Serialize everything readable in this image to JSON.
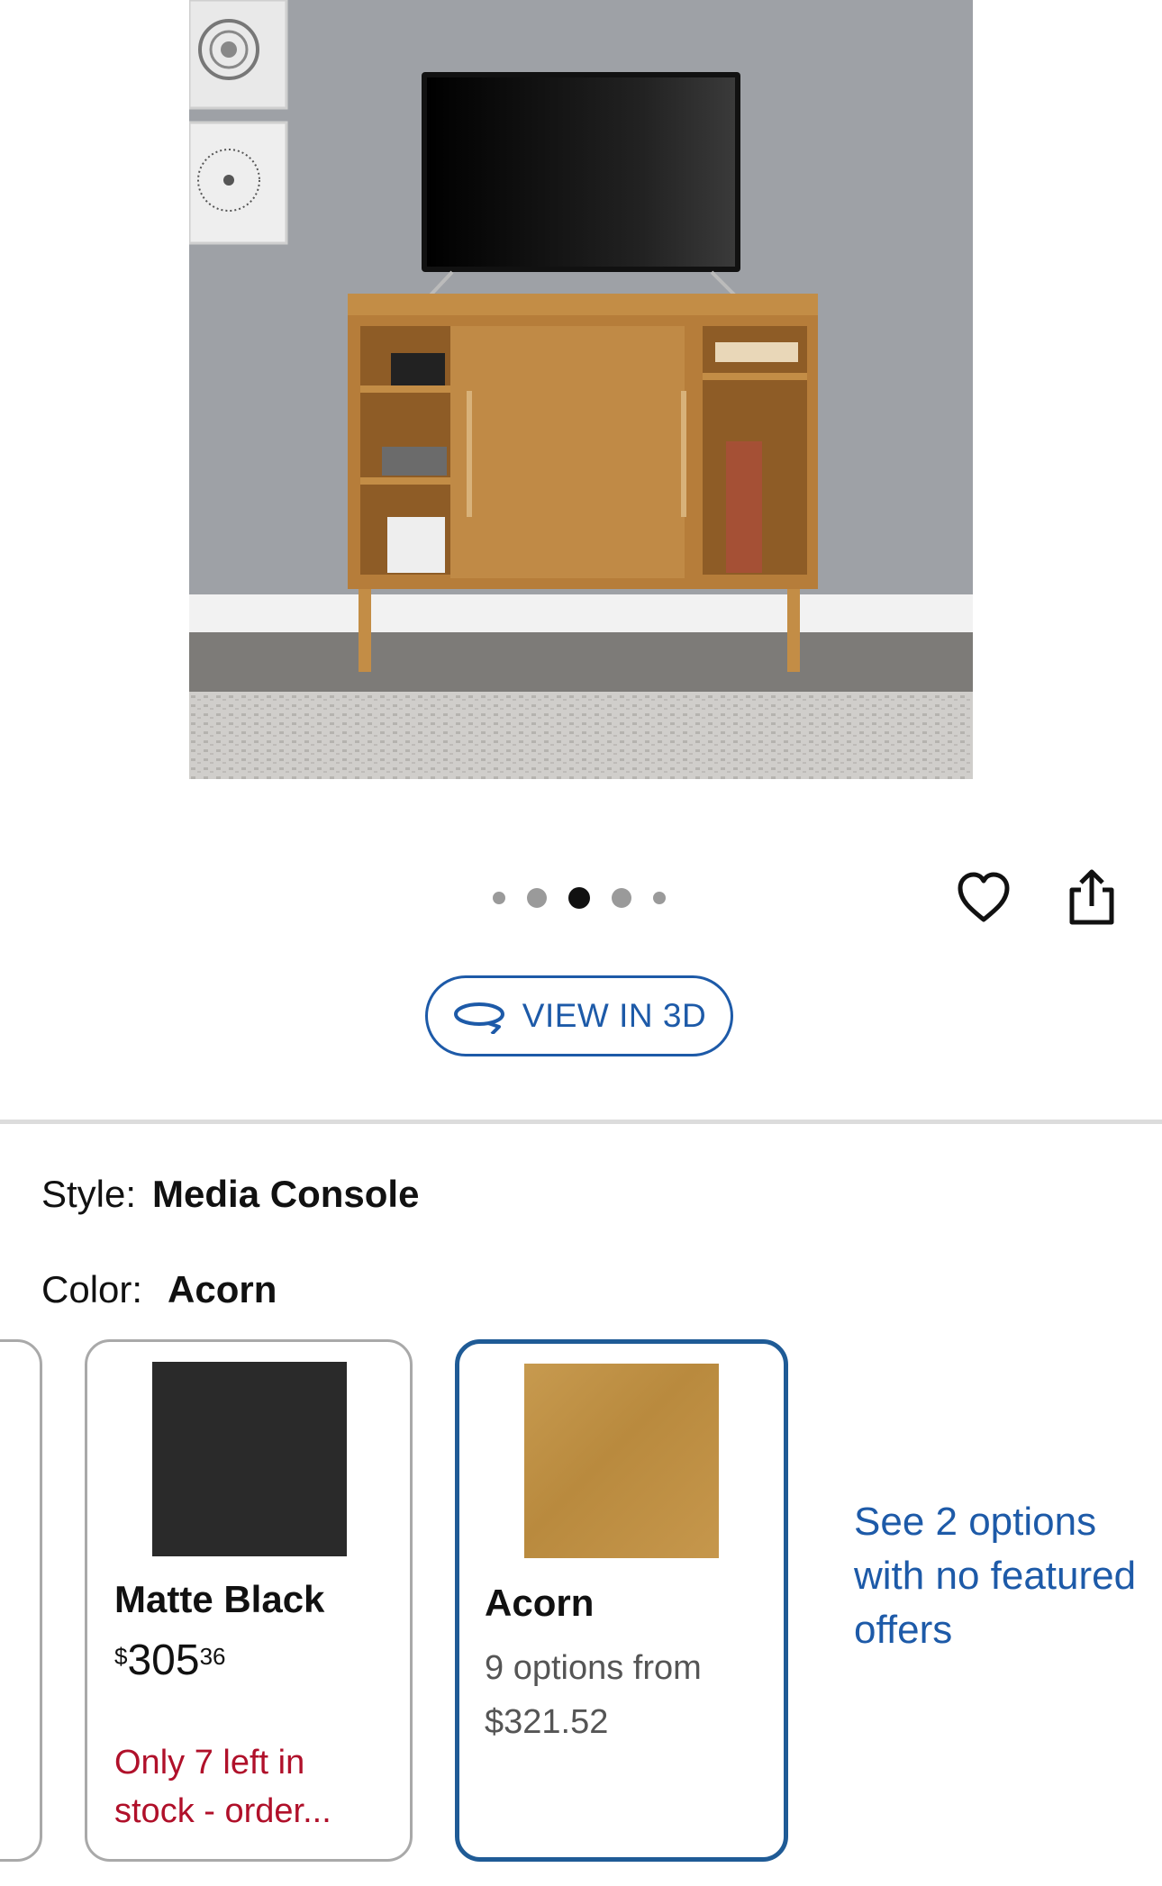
{
  "carousel": {
    "count": 5,
    "active_index": 2
  },
  "actions": {
    "view_3d_label": "VIEW IN 3D"
  },
  "variants": {
    "style_label": "Style:",
    "style_value": "Media Console",
    "color_label": "Color:",
    "color_value": "Acorn"
  },
  "swatches": [
    {
      "name": "Matte Black",
      "color": "#2a2a2a",
      "price_currency": "$",
      "price_dollars": "305",
      "price_cents": "36",
      "stock_note": "Only 7 left in stock - order..."
    },
    {
      "name": "Acorn",
      "color": "#c2924a",
      "selected": true,
      "options_text": "9 options from $321.52"
    }
  ],
  "more_options_link": "See 2 options with no featured offers",
  "colors": {
    "accent": "#1d5aa8",
    "selected_border": "#1f5b96",
    "stock_warning": "#b0102a"
  }
}
